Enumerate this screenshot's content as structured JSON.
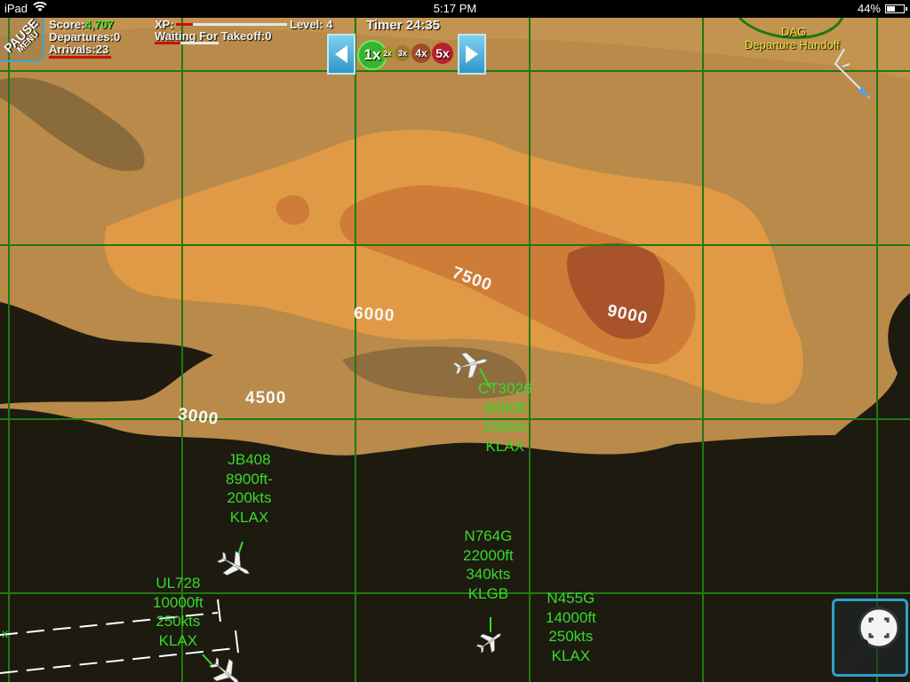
{
  "status_bar": {
    "device": "iPad",
    "time": "5:17 PM",
    "battery": "44%"
  },
  "hud": {
    "score_label": "Score:",
    "score_value": "4,707",
    "departures": "Departures:0",
    "arrivals": "Arrivals:23",
    "xp_label": "XP:",
    "waiting_takeoff": "Waiting For Takeoff:0",
    "level": "Level: 4",
    "timer": "Timer 24:35",
    "pause_label": "PAUSE",
    "menu_label": "MENU"
  },
  "speed_controls": [
    "1x",
    "2x",
    "3x",
    "4x",
    "5x"
  ],
  "handoff": {
    "code": "DAG",
    "label": "Departure Handoff"
  },
  "contour_labels": [
    "7500",
    "6000",
    "9000",
    "4500",
    "3000"
  ],
  "aircraft": [
    {
      "callsign": "CT3026",
      "altitude": "9000ft",
      "speed": "200kts",
      "destination": "KLAX"
    },
    {
      "callsign": "JB408",
      "altitude": "8900ft-",
      "speed": "200kts",
      "destination": "KLAX"
    },
    {
      "callsign": "N764G",
      "altitude": "22000ft",
      "speed": "340kts",
      "destination": "KLGB"
    },
    {
      "callsign": "UL728",
      "altitude": "10000ft",
      "speed": "250kts",
      "destination": "KLAX"
    },
    {
      "callsign": "N455G",
      "altitude": "14000ft",
      "speed": "250kts",
      "destination": "KLAX"
    }
  ],
  "colors": {
    "label_green": "#37d92e",
    "grid": "#1f7a10",
    "accent_blue": "#2f9fd0",
    "handoff_yellow": "#e8e23a"
  },
  "icons": [
    "wifi-icon",
    "battery-icon",
    "airplane-icon",
    "magnifier-icon",
    "runway-icon"
  ]
}
